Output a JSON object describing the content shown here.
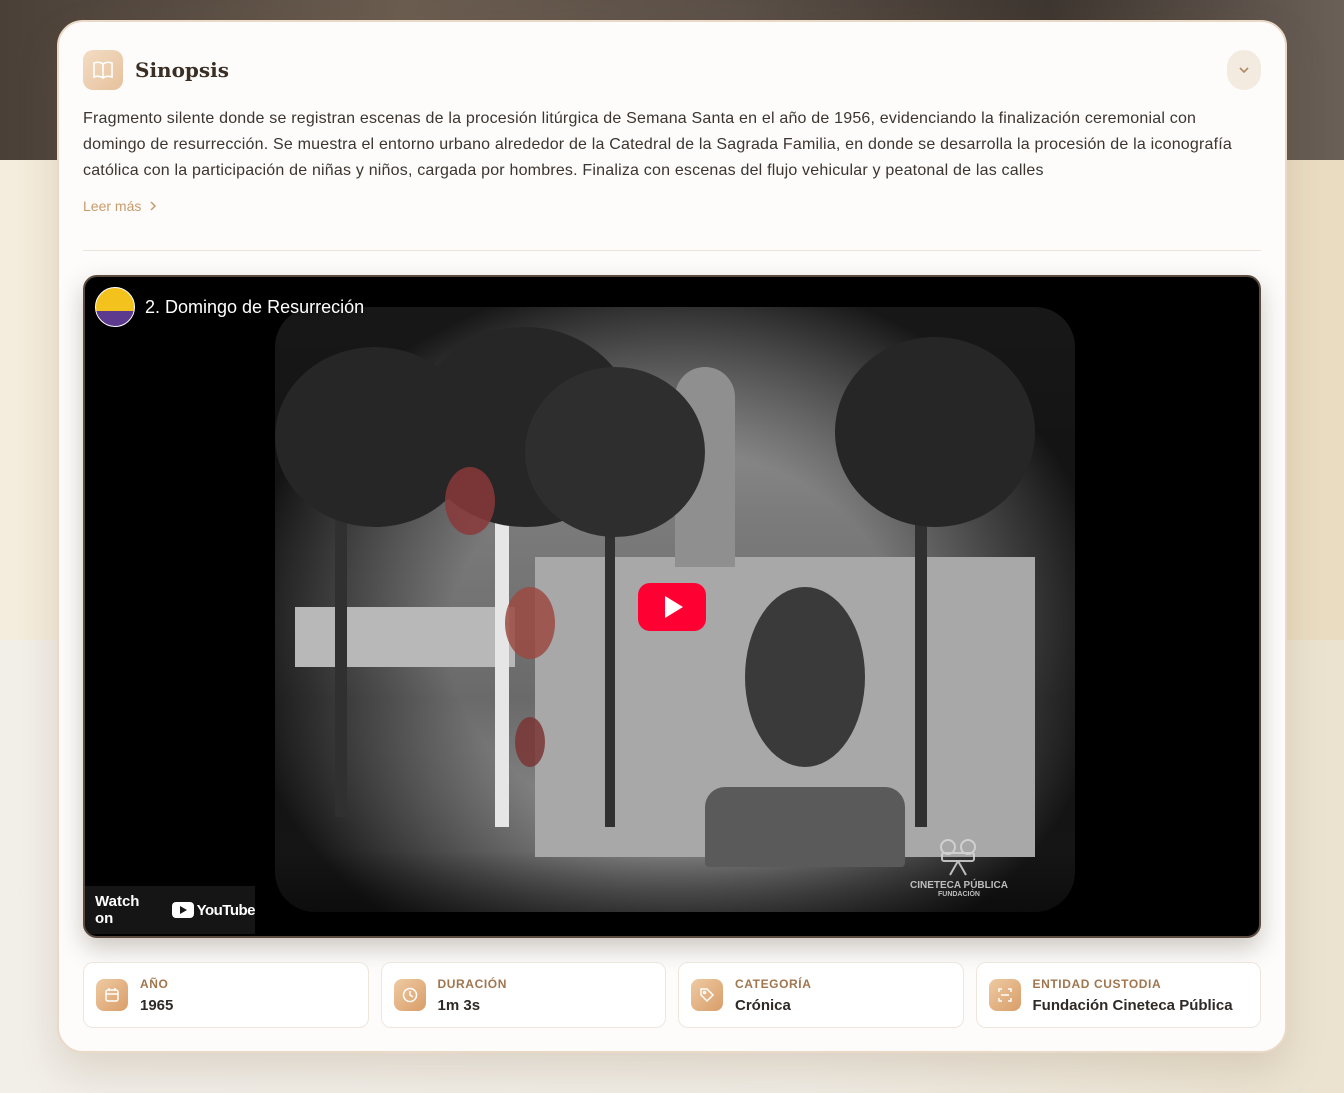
{
  "synopsis": {
    "title": "Sinopsis",
    "text": "Fragmento silente donde se registran escenas de la procesión litúrgica de Semana Santa en el año de 1956, evidenciando la finalización ceremonial con domingo de resurrección. Se muestra el entorno urbano alrededor de la Catedral de la Sagrada Familia, en donde se desarrolla la procesión de la iconografía católica con la participación de niñas y niños, cargada por hombres. Finaliza con escenas del flujo vehicular y peatonal de las calles",
    "read_more_label": "Leer más"
  },
  "video": {
    "title": "2. Domingo de Resurreción",
    "watch_on_label": "Watch on",
    "platform_name": "YouTube",
    "watermark_text": "CINETECA PÚBLICA",
    "watermark_sub": "FUNDACIÓN"
  },
  "meta": [
    {
      "label": "AÑO",
      "value": "1965",
      "icon": "calendar-icon"
    },
    {
      "label": "DURACIÓN",
      "value": "1m 3s",
      "icon": "clock-icon"
    },
    {
      "label": "CATEGORÍA",
      "value": "Crónica",
      "icon": "tag-icon"
    },
    {
      "label": "ENTIDAD CUSTODIA",
      "value": "Fundación Cineteca Pública",
      "icon": "scan-icon"
    }
  ],
  "colors": {
    "accent": "#c99a6a",
    "play_button": "#ff0033"
  }
}
